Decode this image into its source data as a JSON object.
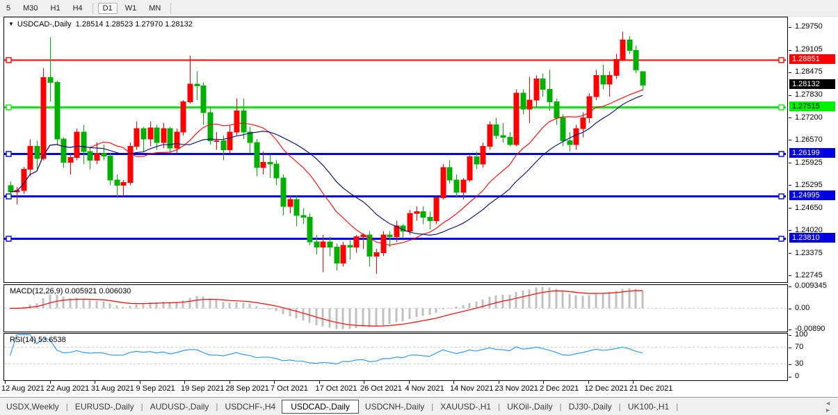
{
  "toolbar": {
    "timeframes": [
      {
        "label": "5",
        "active": false
      },
      {
        "label": "M30",
        "active": false
      },
      {
        "label": "H1",
        "active": false
      },
      {
        "label": "H4",
        "active": false
      },
      {
        "label": "D1",
        "active": true
      },
      {
        "label": "W1",
        "active": false
      },
      {
        "label": "MN",
        "active": false
      }
    ]
  },
  "chart": {
    "title_symbol": "USDCAD-,Daily",
    "title_ohlc": "1.28514 1.28523 1.27970 1.28132",
    "price_axis_ticks": [
      "1.29750",
      "1.29105",
      "1.28475",
      "1.27830",
      "1.27200",
      "1.26570",
      "1.25925",
      "1.25295",
      "1.24650",
      "1.24020",
      "1.23375",
      "1.22745"
    ],
    "hlines": [
      {
        "price": 1.28851,
        "label": "1.28851",
        "color": "#FF0000",
        "text_color": "#FFFFFF",
        "width": 2
      },
      {
        "price": 1.27515,
        "label": "1.27515",
        "color": "#00F000",
        "text_color": "#000000",
        "width": 3
      },
      {
        "price": 1.26199,
        "label": "1.26199",
        "color": "#0000E0",
        "text_color": "#FFFFFF",
        "width": 3
      },
      {
        "price": 1.24995,
        "label": "1.24995",
        "color": "#0000E0",
        "text_color": "#FFFFFF",
        "width": 3
      },
      {
        "price": 1.2381,
        "label": "1.23810",
        "color": "#0000E0",
        "text_color": "#FFFFFF",
        "width": 3
      }
    ],
    "current_price": {
      "price": 1.28132,
      "label": "1.28132",
      "bg": "#000000",
      "text_color": "#FFFFFF"
    }
  },
  "macd_panel": {
    "name": "MACD(12,26,9)",
    "values": "0.005921 0.006030",
    "axis": [
      {
        "label": "0.009345",
        "value": 0.009345
      },
      {
        "label": "0.00",
        "value": 0.0
      },
      {
        "label": "-0.00890",
        "value": -0.0089
      }
    ]
  },
  "rsi_panel": {
    "name": "RSI(14)",
    "value": "53.6538",
    "axis": [
      {
        "label": "100",
        "value": 100
      },
      {
        "label": "70",
        "value": 70
      },
      {
        "label": "30",
        "value": 30
      },
      {
        "label": "0",
        "value": 0
      }
    ],
    "levels": [
      70,
      30
    ]
  },
  "x_axis": {
    "labels": [
      "12 Aug 2021",
      "22 Aug 2021",
      "31 Aug 2021",
      "9 Sep 2021",
      "19 Sep 2021",
      "28 Sep 2021",
      "7 Oct 2021",
      "17 Oct 2021",
      "26 Oct 2021",
      "4 Nov 2021",
      "14 Nov 2021",
      "23 Nov 2021",
      "2 Dec 2021",
      "12 Dec 2021",
      "21 Dec 2021"
    ]
  },
  "tabs": {
    "items": [
      "USDX,Weekly",
      "EURUSD-,Daily",
      "AUDUSD-,Daily",
      "USDCHF-,H4",
      "USDCAD-,Daily",
      "USDCNH-,Daily",
      "XAUUSD-,H1",
      "UKOil-,Daily",
      "DJ30-,Daily",
      "UK100-,H1"
    ],
    "active_index": 4,
    "scroll_left_icon": "◄",
    "scroll_right_icon": "►"
  },
  "colors": {
    "bull": "#FF0000",
    "bear": "#00B000",
    "ma_fast": "#FF0000",
    "ma_slow": "#000078",
    "macd_hist": "#C0C0C0",
    "macd_signal": "#FF0000",
    "rsi_line": "#1E90FF",
    "level_dash": "#CCCCCC"
  },
  "chart_data": {
    "type": "candlestick",
    "symbol": "USDCAD-",
    "timeframe": "Daily",
    "title": "USDCAD-,Daily",
    "price_range": [
      1.22613,
      1.30043
    ],
    "x_labels": [
      "12 Aug 2021",
      "22 Aug 2021",
      "31 Aug 2021",
      "9 Sep 2021",
      "19 Sep 2021",
      "28 Sep 2021",
      "7 Oct 2021",
      "17 Oct 2021",
      "26 Oct 2021",
      "4 Nov 2021",
      "14 Nov 2021",
      "23 Nov 2021",
      "2 Dec 2021",
      "12 Dec 2021",
      "21 Dec 2021"
    ],
    "indicators": {
      "ma_fast": {
        "type": "sma",
        "period": 13
      },
      "ma_slow": {
        "type": "sma",
        "period": 21
      },
      "macd": {
        "fast": 12,
        "slow": 26,
        "signal": 9,
        "main_value": 0.005921,
        "signal_value": 0.00603,
        "axis_max": 0.009345,
        "axis_min": -0.0089
      },
      "rsi": {
        "period": 14,
        "value": 53.6538,
        "levels": [
          70,
          30
        ]
      }
    },
    "candles": [
      [
        1.253,
        1.2542,
        1.2494,
        1.2512
      ],
      [
        1.2512,
        1.2526,
        1.2477,
        1.2516
      ],
      [
        1.2516,
        1.2582,
        1.2506,
        1.2576
      ],
      [
        1.2576,
        1.266,
        1.2556,
        1.2641
      ],
      [
        1.2641,
        1.2656,
        1.2576,
        1.2606
      ],
      [
        1.2606,
        1.2861,
        1.26,
        1.2835
      ],
      [
        1.2835,
        1.2948,
        1.2766,
        1.2821
      ],
      [
        1.2821,
        1.2826,
        1.2646,
        1.2661
      ],
      [
        1.2661,
        1.2666,
        1.258,
        1.2596
      ],
      [
        1.2596,
        1.2621,
        1.2561,
        1.2609
      ],
      [
        1.2609,
        1.2691,
        1.2601,
        1.2681
      ],
      [
        1.2681,
        1.2701,
        1.2591,
        1.2626
      ],
      [
        1.2626,
        1.2641,
        1.2576,
        1.2601
      ],
      [
        1.2601,
        1.2651,
        1.2591,
        1.2621
      ],
      [
        1.2621,
        1.2646,
        1.2601,
        1.2613
      ],
      [
        1.2613,
        1.2621,
        1.2531,
        1.2546
      ],
      [
        1.2546,
        1.2561,
        1.2496,
        1.2531
      ],
      [
        1.2531,
        1.2546,
        1.2501,
        1.2539
      ],
      [
        1.2539,
        1.2651,
        1.2531,
        1.2641
      ],
      [
        1.2641,
        1.2711,
        1.2631,
        1.2691
      ],
      [
        1.2691,
        1.2696,
        1.2626,
        1.2661
      ],
      [
        1.2661,
        1.2711,
        1.2641,
        1.2693
      ],
      [
        1.2693,
        1.2701,
        1.2631,
        1.2651
      ],
      [
        1.2651,
        1.2706,
        1.2636,
        1.2691
      ],
      [
        1.2691,
        1.2696,
        1.2621,
        1.2636
      ],
      [
        1.2636,
        1.2691,
        1.2621,
        1.2681
      ],
      [
        1.2681,
        1.2771,
        1.2671,
        1.2766
      ],
      [
        1.2766,
        1.2896,
        1.2761,
        1.2816
      ],
      [
        1.2816,
        1.2851,
        1.2771,
        1.2811
      ],
      [
        1.2811,
        1.2821,
        1.2701,
        1.2736
      ],
      [
        1.2736,
        1.2751,
        1.2646,
        1.2656
      ],
      [
        1.2656,
        1.2681,
        1.2631,
        1.2656
      ],
      [
        1.2656,
        1.2671,
        1.2601,
        1.2631
      ],
      [
        1.2631,
        1.2701,
        1.2621,
        1.2681
      ],
      [
        1.2681,
        1.2776,
        1.2671,
        1.2741
      ],
      [
        1.2741,
        1.2776,
        1.2661,
        1.2681
      ],
      [
        1.2681,
        1.2696,
        1.2621,
        1.2651
      ],
      [
        1.2651,
        1.2661,
        1.2556,
        1.2581
      ],
      [
        1.2581,
        1.2626,
        1.2561,
        1.2596
      ],
      [
        1.2596,
        1.2616,
        1.2551,
        1.2591
      ],
      [
        1.2591,
        1.2601,
        1.2531,
        1.2551
      ],
      [
        1.2551,
        1.2561,
        1.2446,
        1.2471
      ],
      [
        1.2471,
        1.2501,
        1.2451,
        1.2491
      ],
      [
        1.2491,
        1.2501,
        1.2416,
        1.2446
      ],
      [
        1.2446,
        1.2466,
        1.2421,
        1.2441
      ],
      [
        1.2441,
        1.2451,
        1.2361,
        1.2371
      ],
      [
        1.2371,
        1.2391,
        1.2336,
        1.2356
      ],
      [
        1.2356,
        1.2391,
        1.2286,
        1.2371
      ],
      [
        1.2371,
        1.2386,
        1.2331,
        1.2356
      ],
      [
        1.2356,
        1.2366,
        1.2291,
        1.2311
      ],
      [
        1.2311,
        1.2371,
        1.2301,
        1.2361
      ],
      [
        1.2361,
        1.2376,
        1.2321,
        1.2356
      ],
      [
        1.2356,
        1.2391,
        1.2341,
        1.2386
      ],
      [
        1.2386,
        1.2396,
        1.2351,
        1.2391
      ],
      [
        1.2391,
        1.2401,
        1.2301,
        1.2331
      ],
      [
        1.2331,
        1.2351,
        1.2281,
        1.2341
      ],
      [
        1.2341,
        1.2401,
        1.2331,
        1.2391
      ],
      [
        1.2391,
        1.2401,
        1.2356,
        1.2386
      ],
      [
        1.2386,
        1.2431,
        1.2371,
        1.2416
      ],
      [
        1.2416,
        1.2421,
        1.2381,
        1.2401
      ],
      [
        1.2401,
        1.2461,
        1.2391,
        1.2451
      ],
      [
        1.2451,
        1.2471,
        1.2431,
        1.2456
      ],
      [
        1.2456,
        1.2471,
        1.2421,
        1.2441
      ],
      [
        1.2441,
        1.2456,
        1.2406,
        1.2431
      ],
      [
        1.2431,
        1.2501,
        1.2421,
        1.2496
      ],
      [
        1.2496,
        1.2591,
        1.2491,
        1.2581
      ],
      [
        1.2581,
        1.2601,
        1.2536,
        1.2546
      ],
      [
        1.2546,
        1.2561,
        1.2496,
        1.2511
      ],
      [
        1.2511,
        1.2551,
        1.2491,
        1.2546
      ],
      [
        1.2546,
        1.2616,
        1.2541,
        1.2611
      ],
      [
        1.2611,
        1.2626,
        1.2576,
        1.2591
      ],
      [
        1.2591,
        1.2651,
        1.2581,
        1.2641
      ],
      [
        1.2641,
        1.2711,
        1.2631,
        1.2701
      ],
      [
        1.2701,
        1.2721,
        1.2661,
        1.2671
      ],
      [
        1.2671,
        1.2706,
        1.2651,
        1.2666
      ],
      [
        1.2666,
        1.2681,
        1.2641,
        1.2646
      ],
      [
        1.2646,
        1.2801,
        1.2641,
        1.2791
      ],
      [
        1.2791,
        1.2801,
        1.2731,
        1.2746
      ],
      [
        1.2746,
        1.2837,
        1.2706,
        1.2771
      ],
      [
        1.2771,
        1.2841,
        1.2751,
        1.2831
      ],
      [
        1.2831,
        1.2846,
        1.2781,
        1.2801
      ],
      [
        1.2801,
        1.2856,
        1.2741,
        1.2766
      ],
      [
        1.2766,
        1.2776,
        1.2701,
        1.2721
      ],
      [
        1.2721,
        1.2731,
        1.2641,
        1.2656
      ],
      [
        1.2656,
        1.2681,
        1.2626,
        1.2646
      ],
      [
        1.2646,
        1.2701,
        1.2631,
        1.2691
      ],
      [
        1.2691,
        1.2736,
        1.2666,
        1.2721
      ],
      [
        1.2721,
        1.2791,
        1.2706,
        1.2781
      ],
      [
        1.2781,
        1.2856,
        1.2771,
        1.2841
      ],
      [
        1.2841,
        1.2871,
        1.2801,
        1.2816
      ],
      [
        1.2816,
        1.2851,
        1.2781,
        1.2841
      ],
      [
        1.2841,
        1.2901,
        1.2831,
        1.2886
      ],
      [
        1.2886,
        1.2964,
        1.2881,
        1.2941
      ],
      [
        1.2941,
        1.2951,
        1.2901,
        1.2911
      ],
      [
        1.2911,
        1.2925,
        1.2846,
        1.2856
      ],
      [
        1.28514,
        1.28523,
        1.2797,
        1.28132
      ]
    ]
  }
}
